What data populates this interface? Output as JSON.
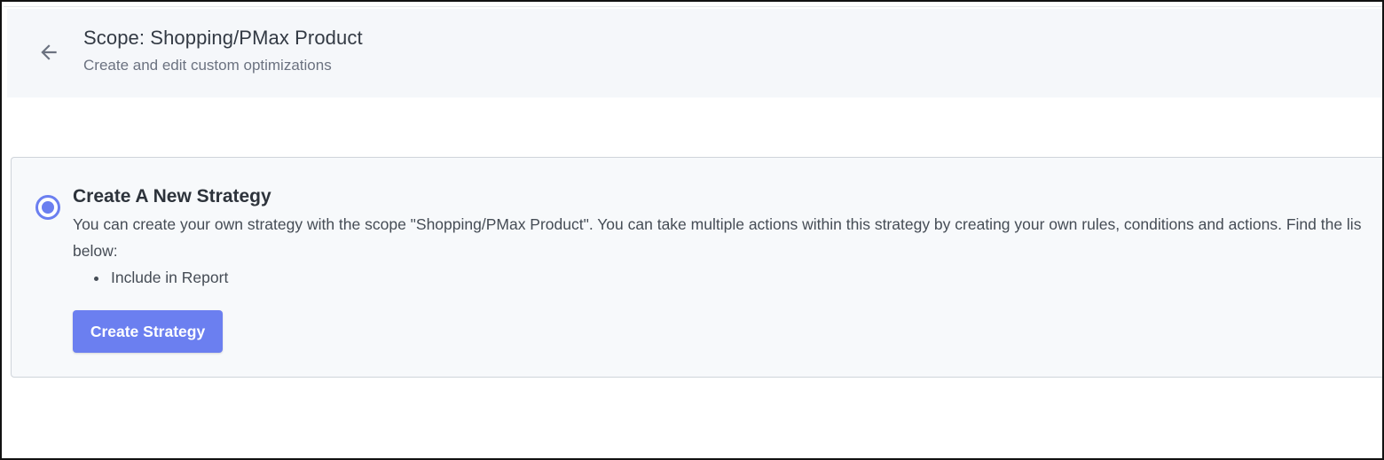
{
  "header": {
    "title": "Scope: Shopping/PMax Product",
    "subtitle": "Create and edit custom optimizations"
  },
  "strategy_option": {
    "selected": true,
    "title": "Create A New Strategy",
    "description_line1": "You can create your own strategy with the scope \"Shopping/PMax Product\". You can take multiple actions within this strategy by creating your own rules, conditions and actions. Find the lis",
    "description_line2": "below:",
    "actions": [
      "Include in Report"
    ],
    "button_label": "Create Strategy"
  },
  "colors": {
    "accent": "#6b7ff0",
    "header_bg": "#f5f7fa",
    "card_bg": "#f7f9fb"
  }
}
